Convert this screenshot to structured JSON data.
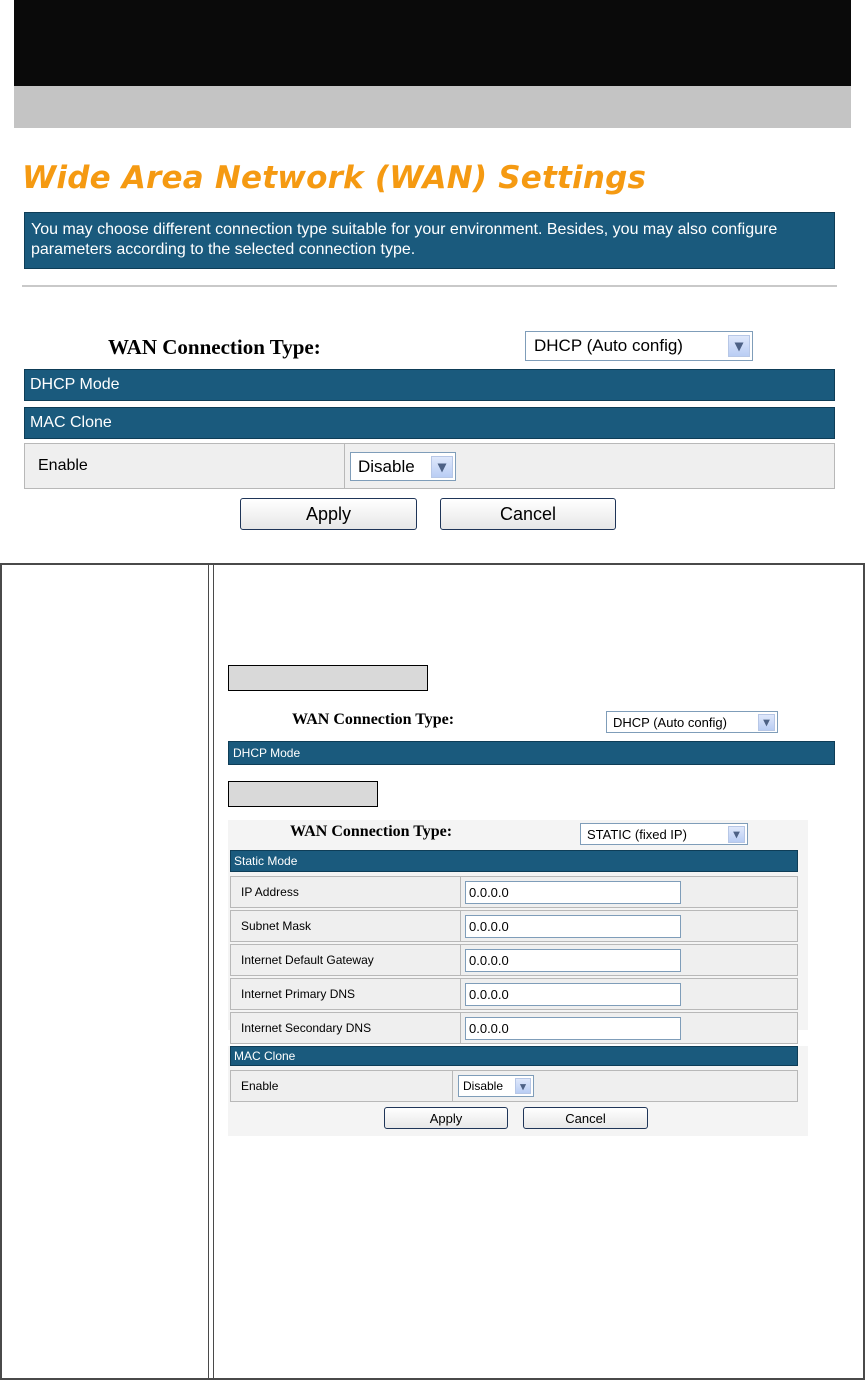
{
  "page": {
    "title": "Wide Area Network (WAN) Settings",
    "description": "You may choose different connection type suitable for your environment. Besides, you may also configure parameters according to the selected connection type."
  },
  "main": {
    "connection_type_label": "WAN Connection Type:",
    "connection_type_value": "DHCP (Auto config)",
    "dhcp_mode_header": "DHCP Mode",
    "mac_clone_header": "MAC Clone",
    "enable_label": "Enable",
    "enable_value": "Disable",
    "apply_label": "Apply",
    "cancel_label": "Cancel"
  },
  "dhcp_example": {
    "connection_type_label": "WAN Connection Type:",
    "connection_type_value": "DHCP (Auto config)",
    "dhcp_mode_header": "DHCP Mode"
  },
  "static_example": {
    "connection_type_label": "WAN Connection Type:",
    "connection_type_value": "STATIC (fixed IP)",
    "static_mode_header": "Static Mode",
    "fields": [
      {
        "label": "IP Address",
        "value": "0.0.0.0"
      },
      {
        "label": "Subnet Mask",
        "value": "0.0.0.0"
      },
      {
        "label": "Internet Default Gateway",
        "value": "0.0.0.0"
      },
      {
        "label": "Internet Primary DNS",
        "value": "0.0.0.0"
      },
      {
        "label": "Internet Secondary DNS",
        "value": "0.0.0.0"
      }
    ],
    "mac_clone_header": "MAC Clone",
    "enable_label": "Enable",
    "enable_value": "Disable",
    "apply_label": "Apply",
    "cancel_label": "Cancel"
  },
  "icons": {
    "dropdown": "chevron-down-icon",
    "dropdown_glyph": "▾"
  },
  "colors": {
    "title": "#f59a12",
    "header_bar": "#1a5a7d",
    "top_bar": "#0a0a0a",
    "sub_bar": "#c4c4c4"
  }
}
